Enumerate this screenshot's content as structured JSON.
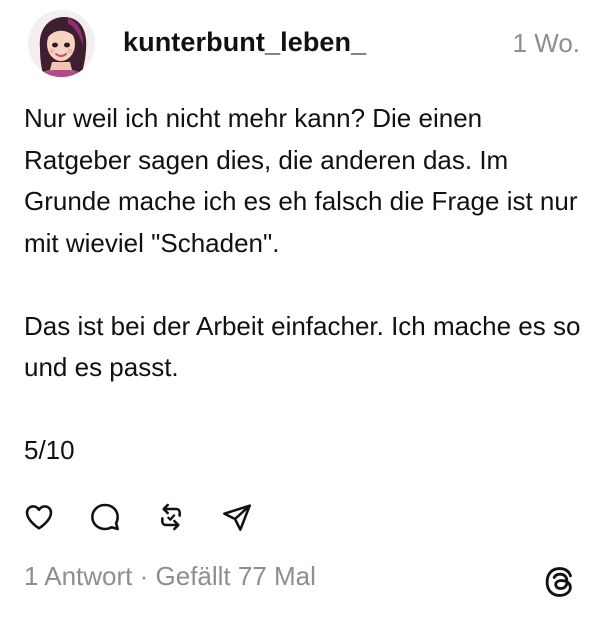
{
  "post": {
    "author": {
      "username": "kunterbunt_leben_",
      "avatar_icon": "profile-avatar"
    },
    "timestamp": "1 Wo.",
    "paragraphs": [
      "Nur weil ich nicht mehr kann? Die einen Ratgeber sagen dies, die anderen das. Im Grunde mache ich es eh falsch die Frage ist nur mit wieviel \"Schaden\".",
      "Das ist bei der Arbeit einfacher. Ich mache es so und es passt.",
      "5/10"
    ],
    "actions": [
      {
        "name": "like",
        "icon": "heart-icon"
      },
      {
        "name": "reply",
        "icon": "comment-icon"
      },
      {
        "name": "repost",
        "icon": "repost-icon"
      },
      {
        "name": "share",
        "icon": "send-icon"
      }
    ],
    "stats": {
      "replies": "1 Antwort",
      "separator": " · ",
      "likes": "Gefällt 77 Mal"
    },
    "brand_icon": "threads-logo-icon"
  }
}
